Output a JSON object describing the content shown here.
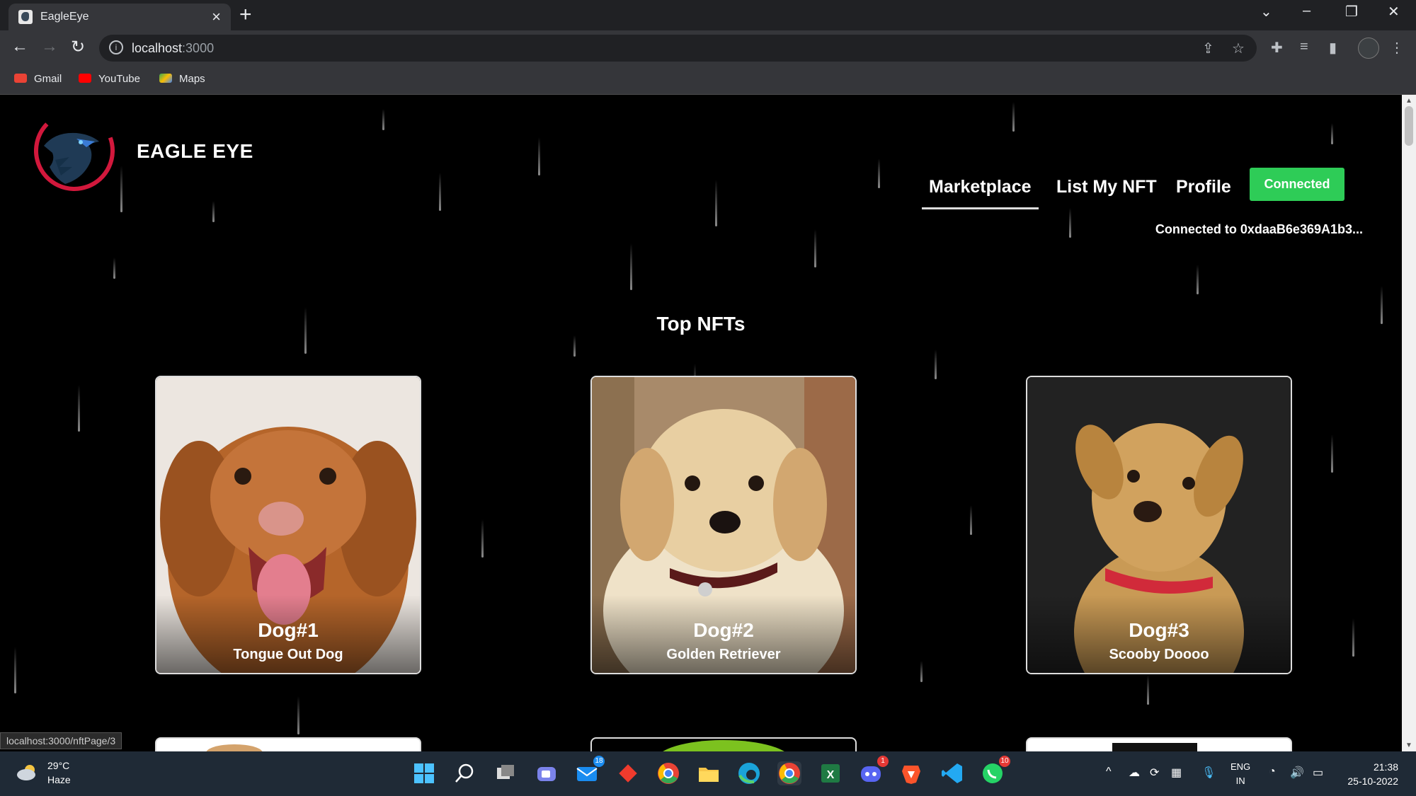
{
  "browser": {
    "tab_title": "EagleEye",
    "tab_close": "×",
    "new_tab": "+",
    "url_host": "localhost",
    "url_port": ":3000",
    "bookmarks": [
      "Gmail",
      "YouTube",
      "Maps"
    ],
    "status_url": "localhost:3000/nftPage/3"
  },
  "site": {
    "brand": "EAGLE EYE",
    "nav": [
      "Marketplace",
      "List My NFT",
      "Profile"
    ],
    "connect_button": "Connected",
    "connected_to": "Connected to 0xdaaB6e369A1b3...",
    "section_title": "Top NFTs",
    "cards": [
      {
        "name": "Dog#1",
        "description": "Tongue Out Dog"
      },
      {
        "name": "Dog#2",
        "description": "Golden Retriever"
      },
      {
        "name": "Dog#3",
        "description": "Scooby Doooo"
      }
    ]
  },
  "taskbar": {
    "temperature": "29°C",
    "weather": "Haze",
    "mail_badge": "18",
    "discord_badge": "1",
    "whatsapp_badge": "10",
    "lang_top": "ENG",
    "lang_bottom": "IN",
    "time": "21:38",
    "date": "25-10-2022"
  },
  "colors": {
    "connect_green": "#2ecc57",
    "page_bg": "#000000",
    "chrome_dark": "#202124"
  }
}
